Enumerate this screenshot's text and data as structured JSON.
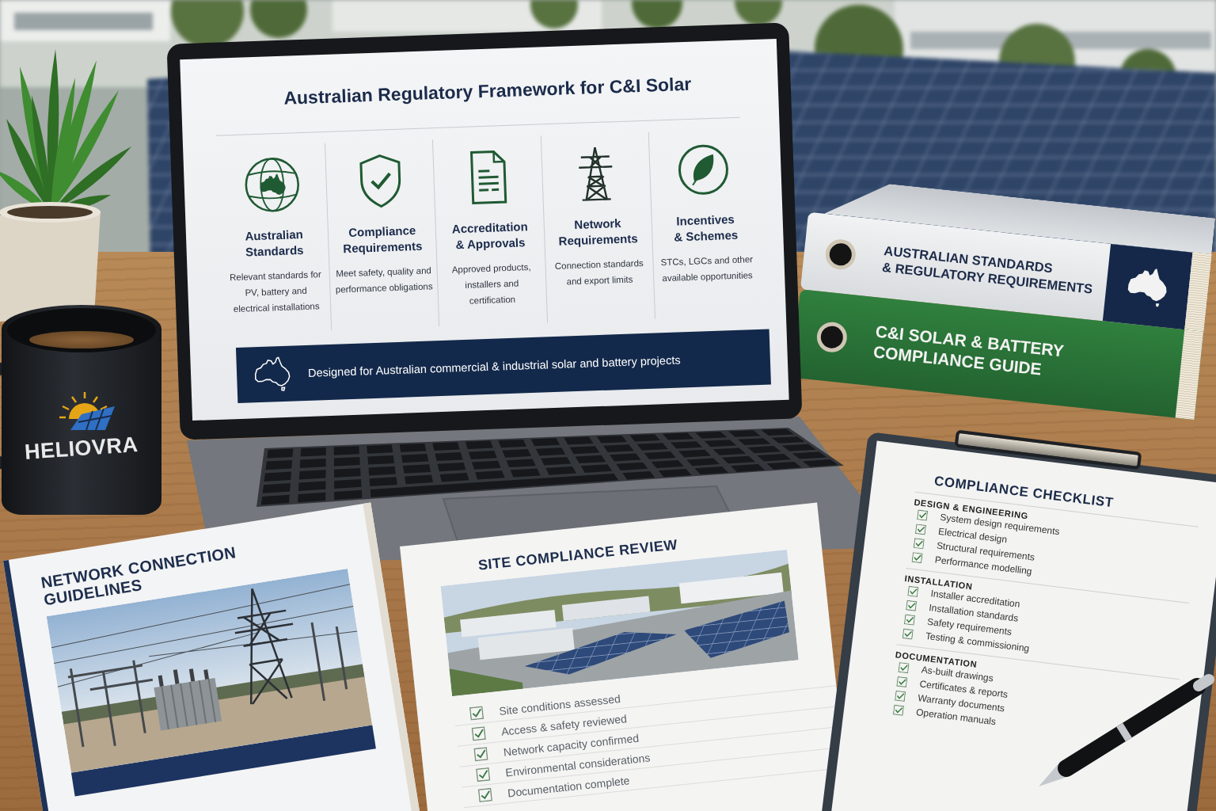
{
  "laptop_slide": {
    "title": "Australian Regulatory Framework for C&I Solar",
    "pillars": [
      {
        "kind": "globe",
        "heading": "Australian\nStandards",
        "text": "Relevant standards for PV, battery and electrical installations"
      },
      {
        "kind": "shield",
        "heading": "Compliance\nRequirements",
        "text": "Meet safety, quality and performance obligations"
      },
      {
        "kind": "document",
        "heading": "Accreditation\n& Approvals",
        "text": "Approved products, installers and certification"
      },
      {
        "kind": "pylon",
        "heading": "Network\nRequirements",
        "text": "Connection standards and export limits"
      },
      {
        "kind": "leaf",
        "heading": "Incentives\n& Schemes",
        "text": "STCs, LGCs and other available opportunities"
      }
    ],
    "banner": "Designed for Australian commercial & industrial solar and battery projects"
  },
  "mug": {
    "brand": "HELIOVRA"
  },
  "binders": [
    {
      "kind": "grey",
      "title": "AUSTRALIAN STANDARDS\n& REGULATORY REQUIREMENTS"
    },
    {
      "kind": "green",
      "title": "C&I SOLAR & BATTERY\nCOMPLIANCE GUIDE"
    }
  ],
  "guidelines_book": {
    "title": "NETWORK CONNECTION\nGUIDELINES"
  },
  "site_review": {
    "title": "SITE COMPLIANCE REVIEW",
    "items": [
      {
        "label": "Site conditions assessed",
        "checked": true
      },
      {
        "label": "Access & safety reviewed",
        "checked": true
      },
      {
        "label": "Network capacity confirmed",
        "checked": true
      },
      {
        "label": "Environmental considerations",
        "checked": true
      },
      {
        "label": "Documentation complete",
        "checked": true
      }
    ]
  },
  "checklist": {
    "title": "COMPLIANCE CHECKLIST",
    "sections": [
      {
        "heading": "DESIGN & ENGINEERING",
        "items": [
          {
            "label": "System design requirements",
            "checked": true
          },
          {
            "label": "Electrical design",
            "checked": true
          },
          {
            "label": "Structural requirements",
            "checked": true
          },
          {
            "label": "Performance modelling",
            "checked": true
          }
        ]
      },
      {
        "heading": "INSTALLATION",
        "items": [
          {
            "label": "Installer accreditation",
            "checked": true
          },
          {
            "label": "Installation standards",
            "checked": true
          },
          {
            "label": "Safety requirements",
            "checked": true
          },
          {
            "label": "Testing & commissioning",
            "checked": true
          }
        ]
      },
      {
        "heading": "DOCUMENTATION",
        "items": [
          {
            "label": "As-built drawings",
            "checked": true
          },
          {
            "label": "Certificates & reports",
            "checked": true
          },
          {
            "label": "Warranty documents",
            "checked": true
          },
          {
            "label": "Operation manuals",
            "checked": true
          }
        ]
      }
    ]
  }
}
